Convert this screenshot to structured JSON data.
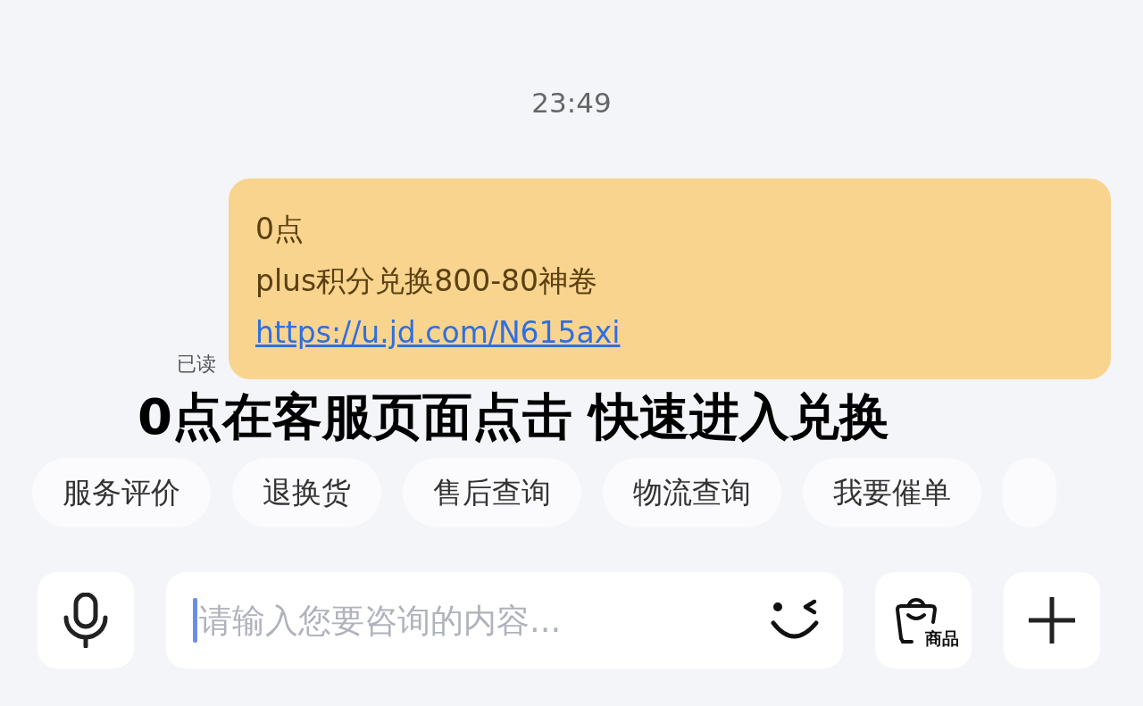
{
  "time": "23:49",
  "message": {
    "lines": [
      "0点",
      "plus积分兑换800-80神卷"
    ],
    "link": "https://u.jd.com/N615axi",
    "status": "已读"
  },
  "caption": "0点在客服页面点击 快速进入兑换",
  "quick_replies": [
    "服务评价",
    "退换货",
    "售后查询",
    "物流查询",
    "我要催单"
  ],
  "input": {
    "placeholder": "请输入您要咨询的内容..."
  },
  "product_button": {
    "label": "商品"
  }
}
